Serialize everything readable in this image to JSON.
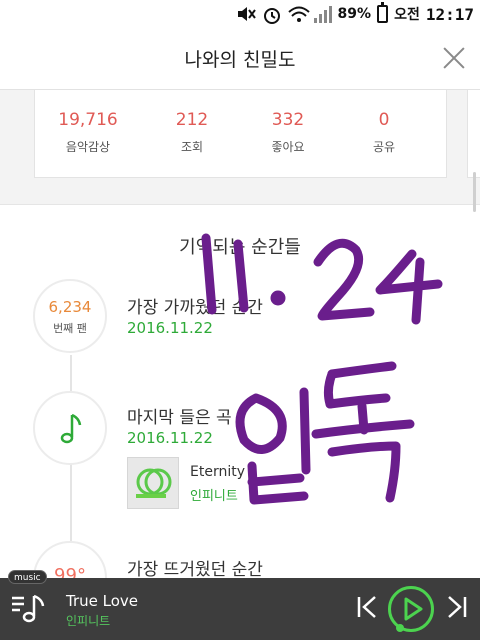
{
  "status_bar": {
    "battery": "89%",
    "period": "오전",
    "time": "12:17"
  },
  "header": {
    "title": "나와의 친밀도"
  },
  "stats": [
    {
      "value": "19,716",
      "label": "음악감상"
    },
    {
      "value": "212",
      "label": "조회"
    },
    {
      "value": "332",
      "label": "좋아요"
    },
    {
      "value": "0",
      "label": "공유"
    }
  ],
  "memories": {
    "section_title": "기억되는 순간들",
    "fan": {
      "number": "6,234",
      "unit": "번째 팬",
      "title": "가장 가까웠던 순간",
      "date": "2016.11.22"
    },
    "last_song": {
      "icon": "music-note-icon",
      "title": "마지막 들은 곡",
      "date": "2016.11.22",
      "track": "Eternity",
      "artist": "인피니트"
    },
    "hottest": {
      "title": "가장 뜨거웠던 순간",
      "circle_text": "99°"
    }
  },
  "handwriting": {
    "line1": "11.24",
    "line2": "입톡",
    "color": "#6a1e8c"
  },
  "player": {
    "badge": "music",
    "title": "True Love",
    "artist": "인피니트",
    "accent": "#4cd34f"
  },
  "colors": {
    "stat_value": "#e05a55",
    "fan_number": "#e8893a",
    "date_green": "#2eaa38"
  }
}
